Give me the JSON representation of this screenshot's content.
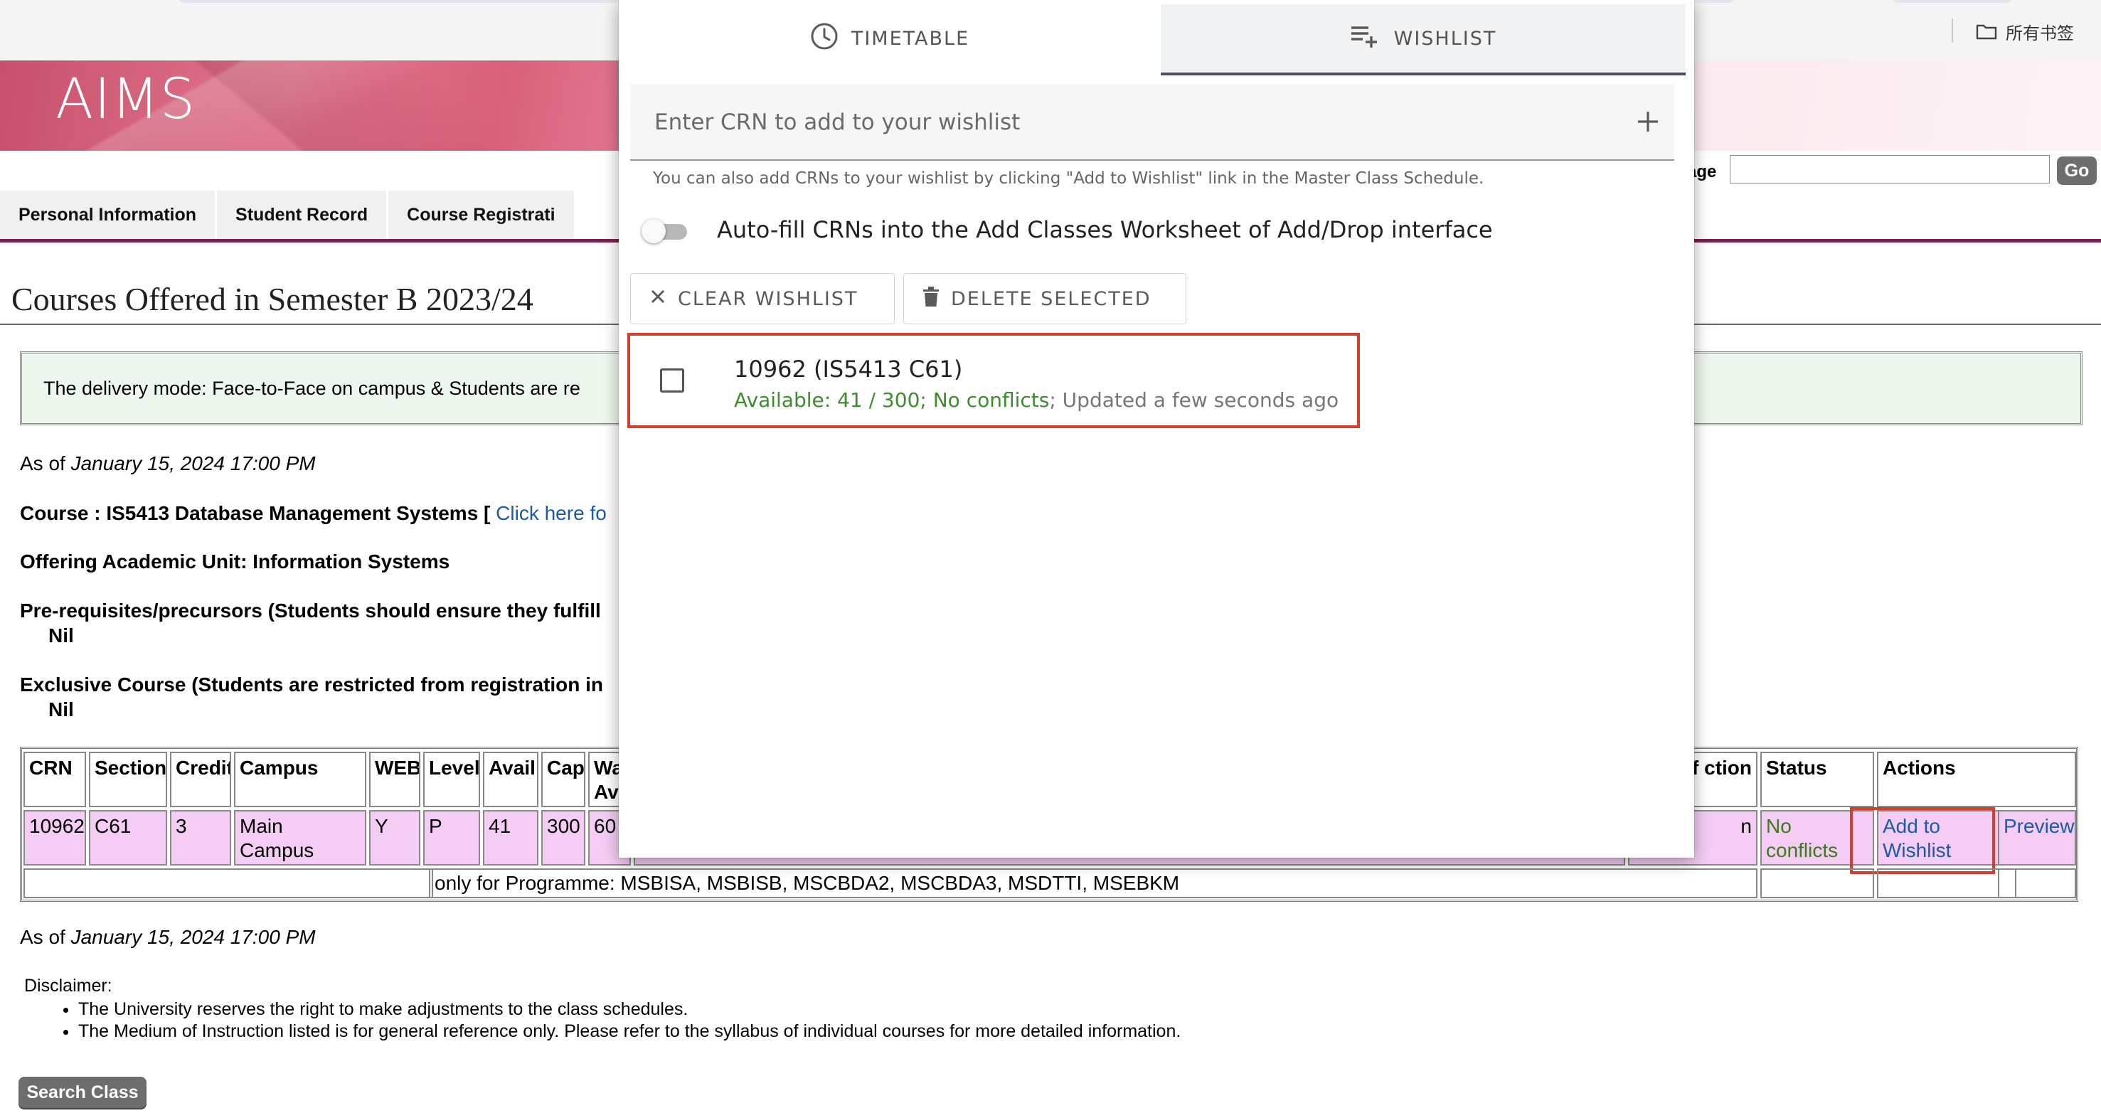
{
  "browser": {
    "bookmarks_label": "所有书签"
  },
  "banner": {
    "logo_text": "AIMS"
  },
  "nav": {
    "tabs": [
      "Personal Information",
      "Student Record",
      "Course Registrati"
    ],
    "goto_label": "age",
    "go_label": "Go"
  },
  "page": {
    "title": "Courses Offered in Semester B 2023/24",
    "notice": "The delivery mode: Face-to-Face on campus & Students are re",
    "as_of_label": "As of ",
    "as_of_date": "January 15, 2024 17:00 PM",
    "course_label": "Course : IS5413 Database Management Systems [ ",
    "course_link": "Click here fo",
    "offering_unit": "Offering Academic Unit: Information Systems",
    "prereq_label": "Pre-requisites/precursors (Students should ensure they fulfill",
    "prereq_value": "Nil",
    "exclusive_label": "Exclusive Course (Students are restricted from registration in",
    "exclusive_value": "Nil",
    "disclaimer_title": "Disclaimer:",
    "disclaimer_items": [
      "The University reserves the right to make adjustments to the class schedules.",
      "The Medium of Instruction listed is for general reference only. Please refer to the syllabus of individual courses for more detailed information."
    ],
    "search_button": "Search Class"
  },
  "class_table": {
    "headers": {
      "crn": "CRN",
      "section": "Section",
      "credit": "Credit",
      "campus": "Campus",
      "web": "WEB",
      "level": "Level",
      "avail": "Avail",
      "cap": "Cap",
      "wait": "Wa Av",
      "medium": "m of ction",
      "status": "Status",
      "actions": "Actions"
    },
    "row": {
      "crn": "10962",
      "section": "C61",
      "credit": "3",
      "campus": "Main Campus",
      "web": "Y",
      "level": "P",
      "avail": "41",
      "cap": "300",
      "wait": "60",
      "medium": "n",
      "status": "No conflicts",
      "add_to_wishlist": "Add to Wishlist",
      "preview": "Preview"
    },
    "remark": "only for Programme: MSBISA, MSBISB, MSCBDA2, MSCBDA3, MSDTTI, MSEBKM"
  },
  "popup": {
    "tab_timetable": "TIMETABLE",
    "tab_wishlist": "WISHLIST",
    "crn_placeholder": "Enter CRN to add to your wishlist",
    "hint": "You can also add CRNs to your wishlist by clicking \"Add to Wishlist\" link in the Master Class Schedule.",
    "autofill_label": "Auto-fill CRNs into the Add Classes Worksheet of Add/Drop interface",
    "clear_button": "CLEAR WISHLIST",
    "delete_button": "DELETE SELECTED",
    "wishlist_items": [
      {
        "title": "10962 (IS5413 C61)",
        "availability": "Available: 41 / 300; No conflicts",
        "updated": "; Updated a few seconds ago"
      }
    ]
  },
  "colors": {
    "accent_maroon": "#7a1f4d",
    "highlight_red": "#d0402f",
    "row_pink": "#f4ccf4",
    "status_green": "#3b7a1e",
    "link_blue": "#1a5aa8"
  }
}
